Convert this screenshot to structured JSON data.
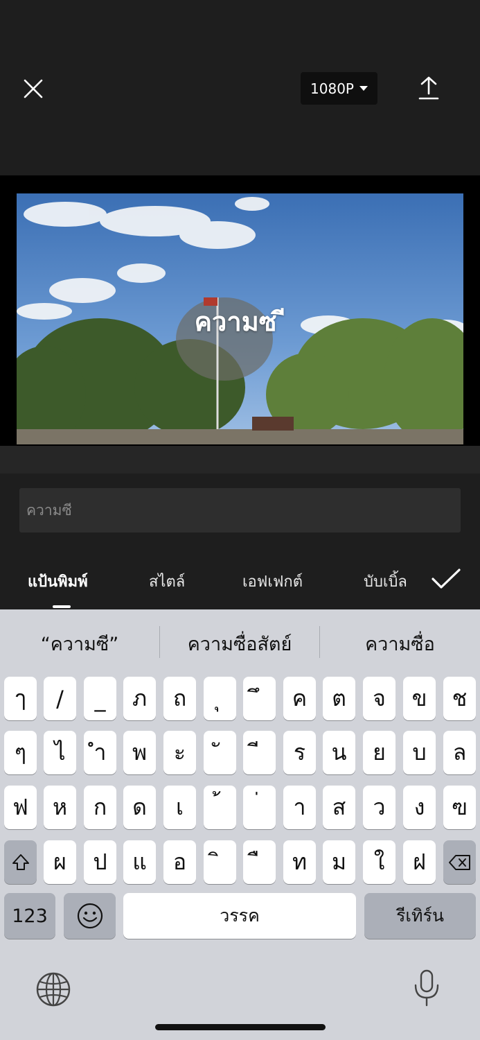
{
  "toolbar": {
    "resolution": "1080P",
    "close_icon": "close-icon",
    "upload_icon": "upload-icon"
  },
  "preview": {
    "overlay_text": "ความซ ี"
  },
  "editor": {
    "input_value": "ความซี",
    "tabs": [
      {
        "label": "แป้นพิมพ์",
        "active": true
      },
      {
        "label": "สไตล์",
        "active": false
      },
      {
        "label": "เอฟเฟกต์",
        "active": false
      },
      {
        "label": "บับเบิ้ล",
        "active": false
      }
    ],
    "confirm_icon": "checkmark-icon"
  },
  "keyboard": {
    "suggestions": [
      "“ความซี”",
      "ความซื่อสัตย์",
      "ความซื่อ"
    ],
    "rows": [
      [
        "ๅ",
        "/",
        "_",
        "ภ",
        "ถ",
        "ุ",
        "ึ",
        "ค",
        "ต",
        "จ",
        "ข",
        "ช"
      ],
      [
        "ๆ",
        "ไ",
        "ำ",
        "พ",
        "ะ",
        "ั",
        "ี",
        "ร",
        "น",
        "ย",
        "บ",
        "ล"
      ],
      [
        "ฟ",
        "ห",
        "ก",
        "ด",
        "เ",
        "้",
        "่",
        "า",
        "ส",
        "ว",
        "ง",
        "ฃ"
      ],
      [
        "ผ",
        "ป",
        "แ",
        "อ",
        "ิ",
        "ื",
        "ท",
        "ม",
        "ใ",
        "ฝ"
      ]
    ],
    "numbers_label": "123",
    "space_label": "วรรค",
    "return_label": "รีเทิร์น",
    "shift_icon": "shift-icon",
    "delete_icon": "backspace-icon",
    "emoji_icon": "emoji-icon",
    "globe_icon": "globe-icon",
    "mic_icon": "microphone-icon"
  }
}
